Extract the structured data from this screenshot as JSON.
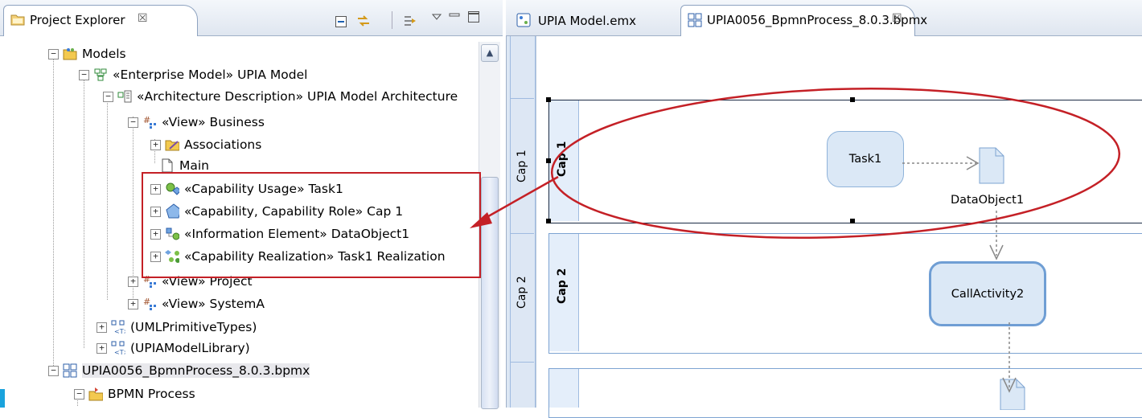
{
  "left": {
    "tab_title": "Project Explorer",
    "tab_close": "☒",
    "tree": [
      {
        "label": "Models",
        "icon": "models-folder-icon"
      },
      {
        "label": "«Enterprise Model» UPIA Model",
        "icon": "enterprise-model-icon"
      },
      {
        "label": "«Architecture Description» UPIA Model Architecture",
        "icon": "architecture-description-icon"
      },
      {
        "label": "«View» Business",
        "icon": "view-icon"
      },
      {
        "label": "Associations",
        "icon": "associations-folder-icon"
      },
      {
        "label": "Main",
        "icon": "diagram-file-icon"
      },
      {
        "label": "«Capability Usage» Task1",
        "icon": "capability-usage-icon"
      },
      {
        "label": "«Capability, Capability Role» Cap 1",
        "icon": "capability-role-icon"
      },
      {
        "label": "«Information Element» DataObject1",
        "icon": "information-element-icon"
      },
      {
        "label": "«Capability Realization» Task1 Realization",
        "icon": "capability-realization-icon"
      },
      {
        "label": "«View» Project",
        "icon": "view-icon"
      },
      {
        "label": "«View» SystemA",
        "icon": "view-icon"
      },
      {
        "label": "(UMLPrimitiveTypes)",
        "icon": "library-icon"
      },
      {
        "label": "(UPIAModelLibrary)",
        "icon": "library-icon"
      },
      {
        "label": "UPIA0056_BpmnProcess_8.0.3.bpmx",
        "icon": "bpmx-file-icon"
      },
      {
        "label": "BPMN Process",
        "icon": "bpmn-process-icon"
      }
    ]
  },
  "right": {
    "tabs": [
      {
        "label": "UPIA Model.emx"
      },
      {
        "label": "UPIA0056_BpmnProcess_8.0.3.bpmx",
        "close": "☒"
      }
    ],
    "lanes": [
      {
        "outer": "Cap 1",
        "inner": "Cap 1"
      },
      {
        "outer": "Cap 2",
        "inner": "Cap 2"
      }
    ],
    "nodes": {
      "task": "Task1",
      "data_object": "DataObject1",
      "call_activity": "CallActivity2"
    }
  },
  "colors": {
    "annotation_red": "#c42026",
    "lane_blue": "#7ea4d2",
    "task_fill": "#dbe8f6"
  }
}
